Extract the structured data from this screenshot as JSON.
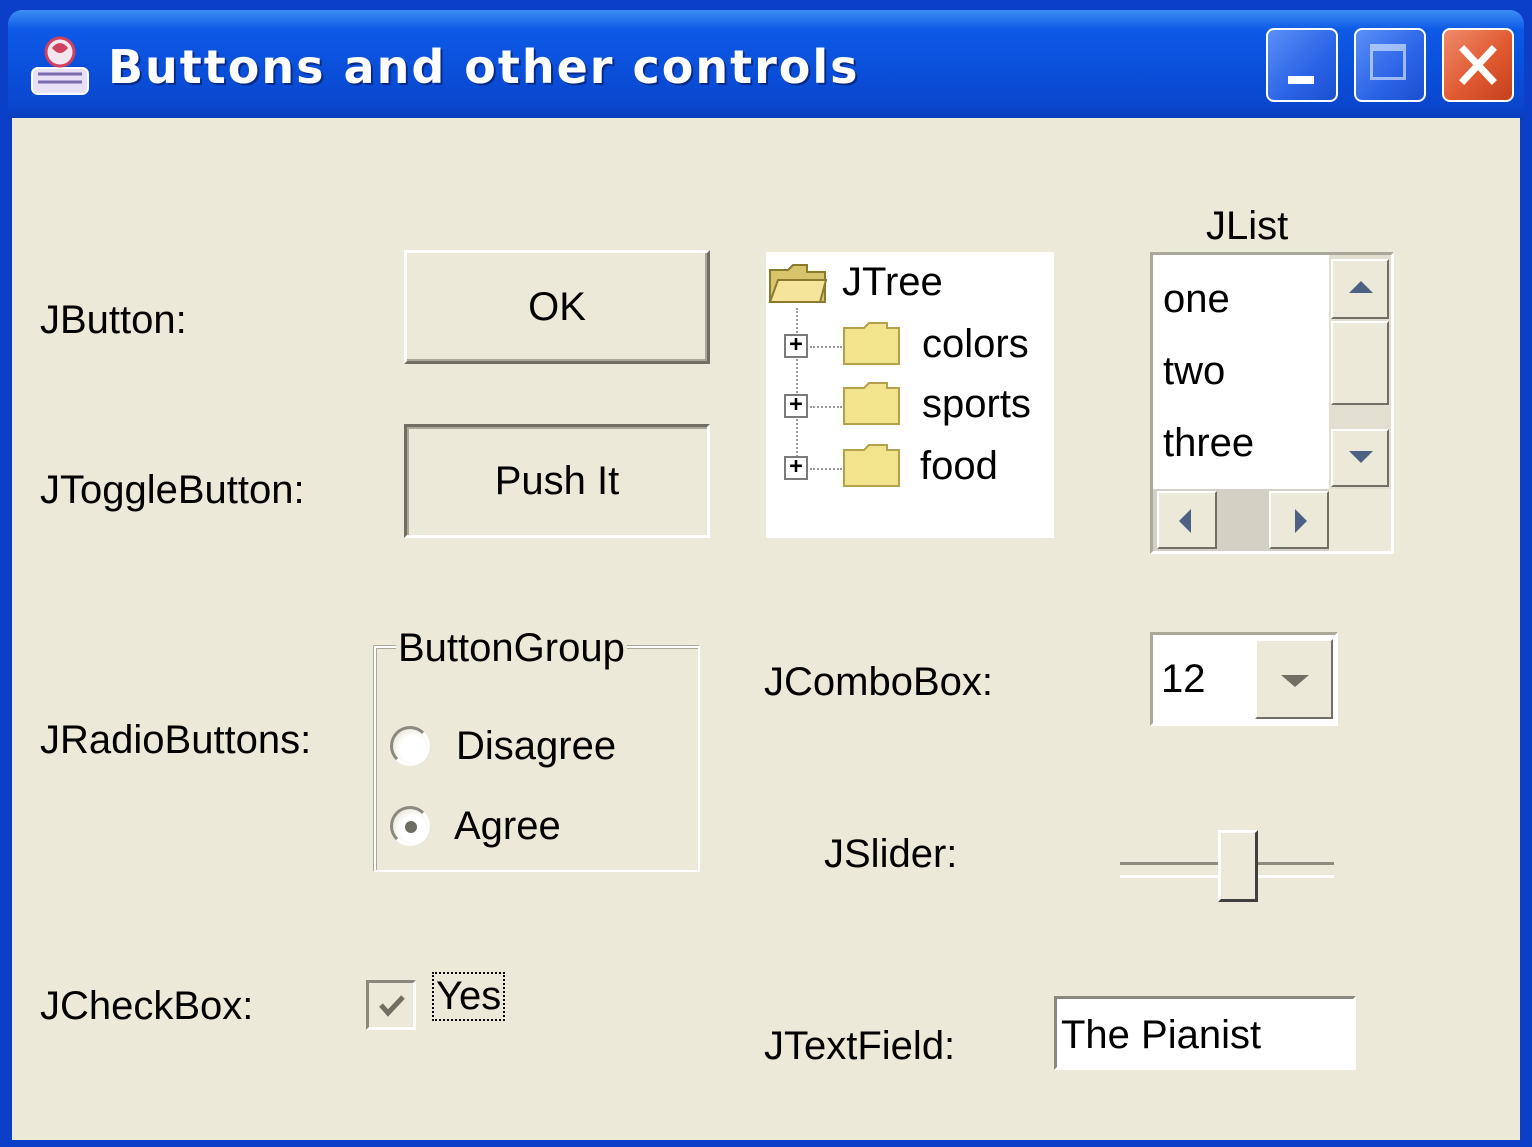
{
  "window": {
    "title": "Buttons and other controls",
    "controls": [
      "minimize-icon",
      "maximize-icon",
      "close-icon"
    ],
    "accent": "#0a4fda",
    "close_color": "#e05a31",
    "background": "#ece9d8"
  },
  "labels": {
    "jbutton": "JButton:",
    "jtogglebutton": "JToggleButton:",
    "jradiobuttons": "JRadioButtons:",
    "jcheckbox": "JCheckBox:",
    "jcombobox": "JComboBox:",
    "jslider": "JSlider:",
    "jtextfield": "JTextField:",
    "jlist": "JList"
  },
  "buttons": {
    "ok": "OK",
    "toggle": "Push It"
  },
  "tree": {
    "root": "JTree",
    "children": [
      "colors",
      "sports",
      "food"
    ]
  },
  "list": {
    "items": [
      "one",
      "two",
      "three"
    ]
  },
  "radio_group": {
    "title": "ButtonGroup",
    "options": [
      "Disagree",
      "Agree"
    ],
    "selected": "Agree"
  },
  "combo": {
    "value": "12"
  },
  "slider": {
    "value_fraction": 0.55
  },
  "checkbox": {
    "label": "Yes",
    "checked": true
  },
  "textfield": {
    "value": "The Pianist"
  }
}
